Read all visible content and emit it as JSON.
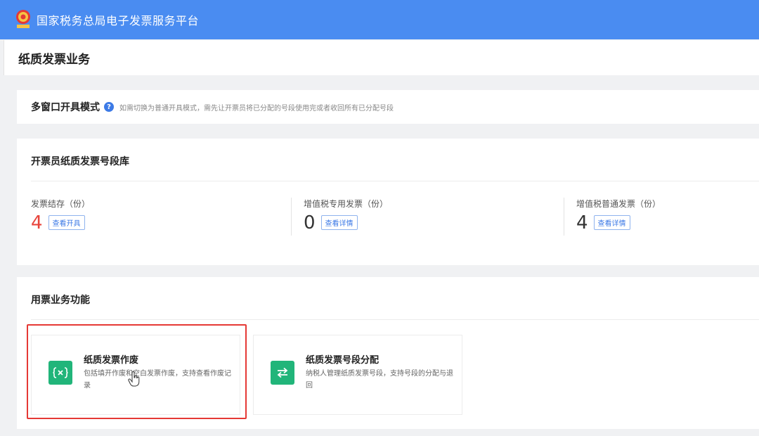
{
  "header": {
    "title": "国家税务总局电子发票服务平台",
    "brand_color": "#4a8cf1"
  },
  "page": {
    "title": "纸质发票业务"
  },
  "mode": {
    "title": "多窗口开具模式",
    "help_icon": "question-circle-icon",
    "hint": "如需切换为普通开具模式，需先让开票员将已分配的号段使用完或者收回所有已分配号段"
  },
  "library": {
    "title": "开票员纸质发票号段库",
    "stats": [
      {
        "label": "发票结存（份）",
        "value": "4",
        "button": "查看开具"
      },
      {
        "label": "增值税专用发票（份）",
        "value": "0",
        "button": "查看详情"
      },
      {
        "label": "增值税普通发票（份）",
        "value": "4",
        "button": "查看详情"
      }
    ]
  },
  "functions": {
    "title": "用票业务功能",
    "tiles": [
      {
        "title": "纸质发票作废",
        "desc": "包括填开作废和空白发票作废，支持查看作废记录",
        "icon": "void-invoice-icon"
      },
      {
        "title": "纸质发票号段分配",
        "desc": "纳税人管理纸质发票号段，支持号段的分配与退回",
        "icon": "transfer-arrows-icon"
      }
    ]
  },
  "colors": {
    "accent": "#3c7ae6",
    "highlight": "#e53935",
    "tile_icon_bg": "#21b57a",
    "stock_value": "#e8453c"
  }
}
